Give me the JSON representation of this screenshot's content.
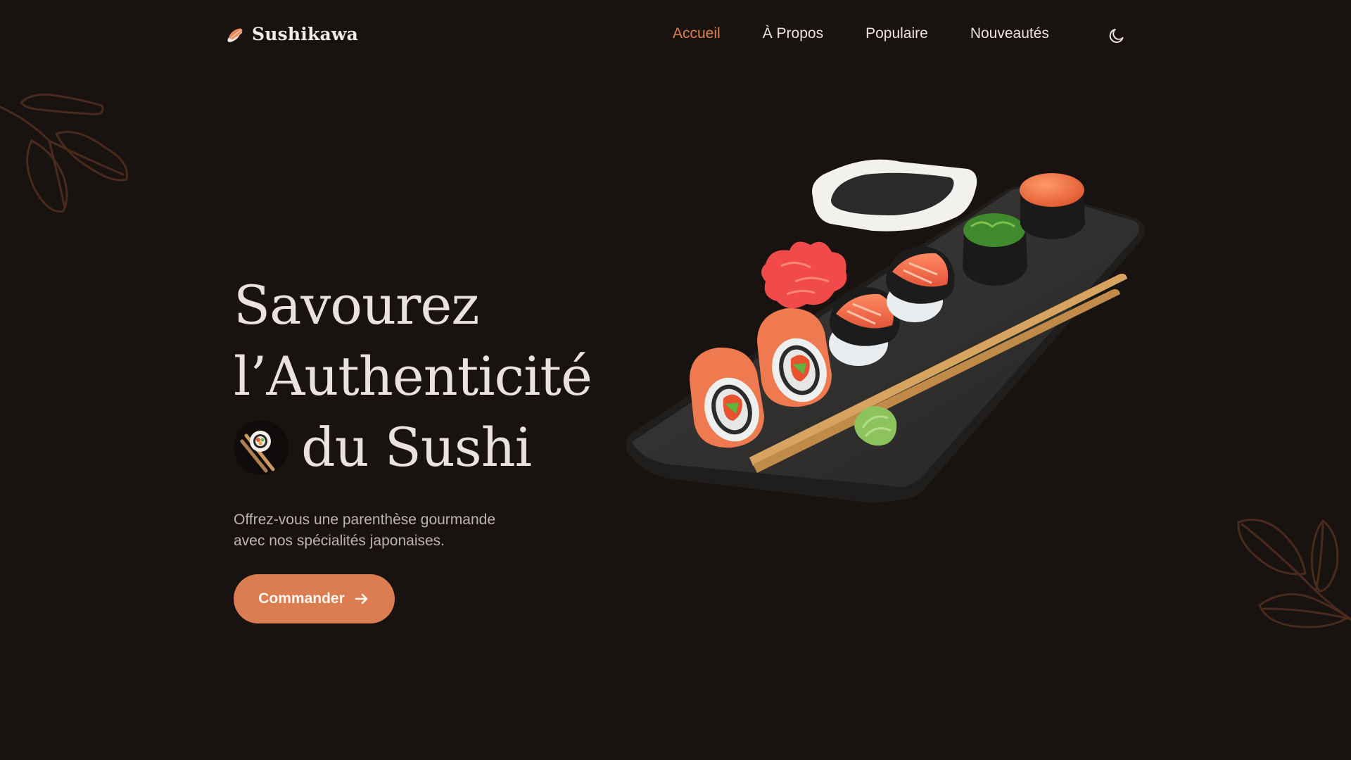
{
  "header": {
    "logo_text": "Sushikawa",
    "logo_icon": "sushi-nigiri-icon",
    "nav": [
      {
        "label": "Accueil",
        "active": true
      },
      {
        "label": "À Propos",
        "active": false
      },
      {
        "label": "Populaire",
        "active": false
      },
      {
        "label": "Nouveautés",
        "active": false
      }
    ],
    "theme_toggle_icon": "moon-icon"
  },
  "hero": {
    "title_line1": "Savourez",
    "title_line2": "l’Authenticité",
    "title_line3": "du Sushi",
    "title_badge_icon": "sushi-chopsticks-icon",
    "subtitle": "Offrez-vous une parenthèse gourmande avec nos spécialités japonaises.",
    "cta_label": "Commander",
    "cta_icon": "arrow-right-icon",
    "image": "sushi-plate-illustration"
  },
  "colors": {
    "background": "#181311",
    "accent": "#dc7c51",
    "text": "#ebe1dd",
    "muted_text": "#bfb3ae",
    "leaf_outline": "#4a2a1d"
  }
}
